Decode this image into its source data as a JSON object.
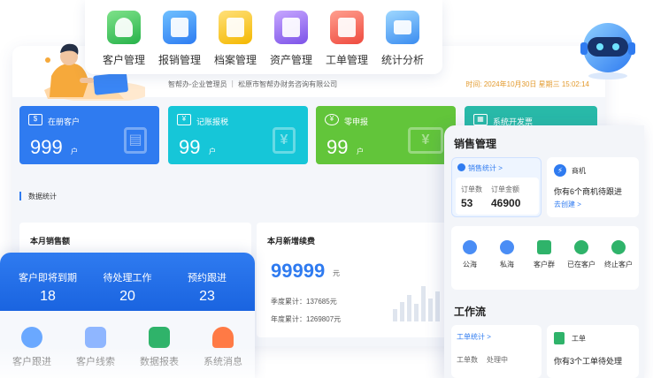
{
  "topbar": {
    "items": [
      {
        "label": "客户管理",
        "icon": "customer-icon"
      },
      {
        "label": "报销管理",
        "icon": "expense-icon"
      },
      {
        "label": "档案管理",
        "icon": "archive-icon"
      },
      {
        "label": "资产管理",
        "icon": "asset-icon"
      },
      {
        "label": "工单管理",
        "icon": "ticket-icon"
      },
      {
        "label": "统计分析",
        "icon": "stats-icon"
      }
    ]
  },
  "dashboard": {
    "subtitle": "智帮办-企业管理员 ｜ 松原市智帮办财务咨询有限公司",
    "time": "时间: 2024年10月30日 星期三 15:02:14",
    "cards": [
      {
        "label": "在册客户",
        "value": "999",
        "unit": "户",
        "color": "#2f7bf0"
      },
      {
        "label": "记账报税",
        "value": "99",
        "unit": "户",
        "color": "#16c6d8"
      },
      {
        "label": "零申报",
        "value": "99",
        "unit": "户",
        "color": "#62c53a"
      },
      {
        "label": "系统开发票",
        "color": "#28b9a8"
      }
    ],
    "section_title": "数据统计",
    "monthly_sales_title": "本月销售额",
    "new_renewal": {
      "title": "本月新增续费",
      "value": "99999",
      "unit": "元",
      "quarter_label": "季度累计：",
      "quarter_value": "137685元",
      "year_label": "年度累计：",
      "year_value": "1269807元"
    }
  },
  "sales_panel": {
    "title": "销售管理",
    "stats_header": "销售统计 >",
    "order_count_label": "订单数",
    "order_count": "53",
    "order_amount_label": "订单金额",
    "order_amount": "46900",
    "opportunity_title": "商机",
    "opportunity_desc": "你有6个商机待跟进",
    "opportunity_link": "去创建 >",
    "menu": [
      {
        "label": "公海",
        "color": "#4a8df5"
      },
      {
        "label": "私海",
        "color": "#4a8df5"
      },
      {
        "label": "客户群",
        "color": "#2fb36a"
      },
      {
        "label": "已在客户",
        "color": "#2fb36a"
      },
      {
        "label": "终止客户",
        "color": "#2fb36a"
      }
    ],
    "workflow_title": "工作流",
    "work_stats_header": "工单统计 >",
    "work_labels": [
      "工单数",
      "处理中"
    ],
    "ticket_title": "工单",
    "ticket_desc": "你有3个工单待处理"
  },
  "mobile": {
    "stats": [
      {
        "label": "客户即将到期",
        "value": "18"
      },
      {
        "label": "待处理工作",
        "value": "20"
      },
      {
        "label": "预约跟进",
        "value": "23"
      }
    ],
    "nav": [
      {
        "label": "客户跟进",
        "color": "#6aa8ff"
      },
      {
        "label": "客户线索",
        "color": "#8fb6ff"
      },
      {
        "label": "数据报表",
        "color": "#2fb36a"
      },
      {
        "label": "系统消息",
        "color": "#ff7a45"
      }
    ]
  }
}
